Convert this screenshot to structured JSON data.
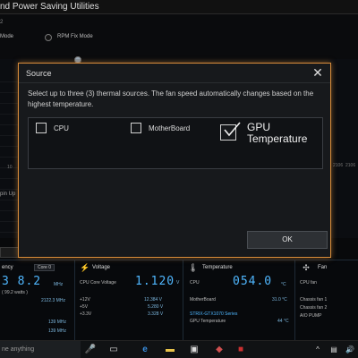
{
  "window": {
    "title": "nd Power Saving Utilities",
    "subtitle": "2"
  },
  "modes": [
    {
      "label": "Mode"
    },
    {
      "label": "RPM Fix Mode"
    }
  ],
  "background": {
    "axis_value": "10",
    "side_labels": [
      "2106",
      "2106"
    ],
    "spin_up_label": "pin Up"
  },
  "dialog": {
    "title": "Source",
    "close_glyph": "✕",
    "description": "Select up to three (3) thermal sources. The fan speed automatically changes based on the highest temperature.",
    "options": [
      {
        "label": "CPU",
        "checked": false
      },
      {
        "label": "MotherBoard",
        "checked": false
      },
      {
        "label": "GPU Temperature",
        "checked": true
      }
    ],
    "ok_label": "OK"
  },
  "dashboard": {
    "frequency": {
      "title": "ency",
      "core_select": "Core 0",
      "big": "3 8.2",
      "unit": "MHz",
      "sub": "( 99.2  watts )",
      "rows": [
        {
          "value": "2122.3  MHz"
        },
        {
          "value": "139 MHz"
        },
        {
          "value": "139 MHz"
        }
      ]
    },
    "voltage": {
      "title": "Voltage",
      "label": "CPU Core Voltage",
      "big": "1.120",
      "unit": "V",
      "rows": [
        {
          "label": "+12V",
          "value": "12.384  V"
        },
        {
          "label": "+5V",
          "value": "5.280  V"
        },
        {
          "label": "+3.3V",
          "value": "3.328  V"
        }
      ]
    },
    "temperature": {
      "title": "Temperature",
      "label": "CPU",
      "big": "054.0",
      "unit": "°C",
      "rows": [
        {
          "label": "MotherBoard",
          "value": "31.0 °C"
        },
        {
          "label": "STRIX-GTX1070 Series",
          "value": ""
        },
        {
          "label": "GPU Temperature",
          "value": "44 °C"
        }
      ]
    },
    "fan": {
      "title": "Fan",
      "label": "CPU fan",
      "rows": [
        {
          "label": "Chassis fan 1"
        },
        {
          "label": "Chassis fan 2"
        },
        {
          "label": "AIO PUMP"
        }
      ]
    }
  },
  "taskbar": {
    "search_placeholder": "ne anything",
    "icons": [
      "mic-icon",
      "task-view-icon",
      "edge-icon",
      "file-explorer-icon",
      "store-icon",
      "app-icon",
      "app-icon-2"
    ]
  }
}
